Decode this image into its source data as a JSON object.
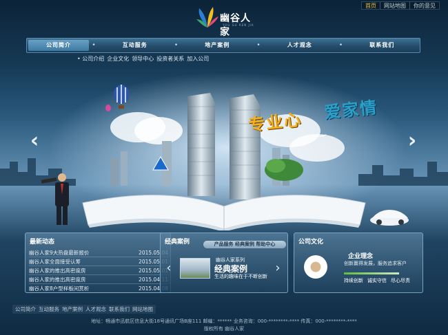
{
  "top_links": [
    "首页",
    "网站地图",
    "你的意见"
  ],
  "logo": {
    "name": "幽谷人家",
    "sub": "YOU GU REN JIA"
  },
  "nav": {
    "items": [
      "公司简介",
      "互动服务",
      "地产案例",
      "人才观念",
      "联系我们"
    ],
    "separator": "•"
  },
  "subnav": [
    "• 公司介绍",
    "企业文化",
    "领导中心",
    "投资者关系",
    "加入公司"
  ],
  "banner": {
    "slogan_gold": "专业心",
    "slogan_blue": "爱家情",
    "left_arrow": "‹",
    "right_arrow": "›"
  },
  "news": {
    "title": "最新动态",
    "rows": [
      {
        "text": "幽谷人家9大热盘最新报价",
        "date": "2015.05.04"
      },
      {
        "text": "幽谷人家全面接受认筹",
        "date": "2015.05.01"
      },
      {
        "text": "幽谷人家的推出高密度房",
        "date": "2015.05.01"
      },
      {
        "text": "幽谷人家的推出高密度房",
        "date": "2015.04.11"
      },
      {
        "text": "幽谷人家8户型样板间赏析",
        "date": "2015.04.08"
      }
    ]
  },
  "cases": {
    "title": "经典案例",
    "tags": "产品服务 经典案例 帮助中心",
    "series": "幽谷人家系列",
    "heading": "经典案例",
    "desc": "生活的趣味在于不断创新",
    "prev": "‹",
    "next": "›"
  },
  "culture": {
    "title": "公司文化",
    "head": "企业理念",
    "text": "创新赢得发展，服务追求客户",
    "links": [
      "持续创新",
      "诚实守信",
      "尽心尽责"
    ]
  },
  "footer": {
    "links": [
      "公司简介",
      "互动服务",
      "地产案例",
      "人才观念",
      "联系我们",
      "网站地图"
    ],
    "address": "地址：畅通市迅航区信息大街18号通讯广场B座111   邮编：******   业务咨询：000-********-****   传真：000-********-****",
    "copyright": "版权所有  幽谷人家"
  }
}
